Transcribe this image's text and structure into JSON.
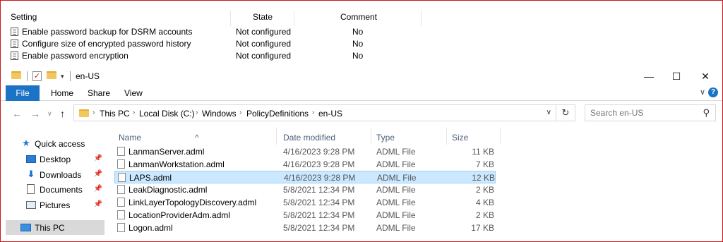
{
  "policy": {
    "headers": {
      "setting": "Setting",
      "state": "State",
      "comment": "Comment"
    },
    "rows": [
      {
        "setting": "Enable password backup for DSRM accounts",
        "state": "Not configured",
        "comment": "No"
      },
      {
        "setting": "Configure size of encrypted password history",
        "state": "Not configured",
        "comment": "No"
      },
      {
        "setting": "Enable password encryption",
        "state": "Not configured",
        "comment": "No"
      }
    ]
  },
  "window": {
    "title": "en-US",
    "minimize": "—",
    "maximize": "☐",
    "close": "✕"
  },
  "ribbon": {
    "tabs": {
      "file": "File",
      "home": "Home",
      "share": "Share",
      "view": "View"
    },
    "expand": "∨",
    "help": "?"
  },
  "nav": {
    "back": "←",
    "forward": "→",
    "recent": "∨",
    "up": "↑",
    "breadcrumb": [
      "This PC",
      "Local Disk (C:)",
      "Windows",
      "PolicyDefinitions",
      "en-US"
    ],
    "crumb_sep": "›",
    "refresh": "↻",
    "search_placeholder": "Search en-US"
  },
  "navpane": {
    "items": [
      {
        "label": "Quick access",
        "icon": "star-icon",
        "pinned": false
      },
      {
        "label": "Desktop",
        "icon": "desktop-icon",
        "pinned": true
      },
      {
        "label": "Downloads",
        "icon": "download-icon",
        "pinned": true
      },
      {
        "label": "Documents",
        "icon": "documents-icon",
        "pinned": true
      },
      {
        "label": "Pictures",
        "icon": "pictures-icon",
        "pinned": true
      },
      {
        "label": "This PC",
        "icon": "computer-icon",
        "pinned": false,
        "selected": true
      }
    ]
  },
  "filelist": {
    "columns": {
      "name": "Name",
      "date": "Date modified",
      "type": "Type",
      "size": "Size"
    },
    "rows": [
      {
        "name": "LanmanServer.adml",
        "date": "4/16/2023 9:28 PM",
        "type": "ADML File",
        "size": "11 KB"
      },
      {
        "name": "LanmanWorkstation.adml",
        "date": "4/16/2023 9:28 PM",
        "type": "ADML File",
        "size": "7 KB"
      },
      {
        "name": "LAPS.adml",
        "date": "4/16/2023 9:28 PM",
        "type": "ADML File",
        "size": "12 KB",
        "selected": true
      },
      {
        "name": "LeakDiagnostic.adml",
        "date": "5/8/2021 12:34 PM",
        "type": "ADML File",
        "size": "2 KB"
      },
      {
        "name": "LinkLayerTopologyDiscovery.adml",
        "date": "5/8/2021 12:34 PM",
        "type": "ADML File",
        "size": "4 KB"
      },
      {
        "name": "LocationProviderAdm.adml",
        "date": "5/8/2021 12:34 PM",
        "type": "ADML File",
        "size": "2 KB"
      },
      {
        "name": "Logon.adml",
        "date": "5/8/2021 12:34 PM",
        "type": "ADML File",
        "size": "17 KB"
      }
    ]
  },
  "colors": {
    "accent": "#1a73c5",
    "selection": "#cce8ff",
    "frame": "#c81818"
  }
}
